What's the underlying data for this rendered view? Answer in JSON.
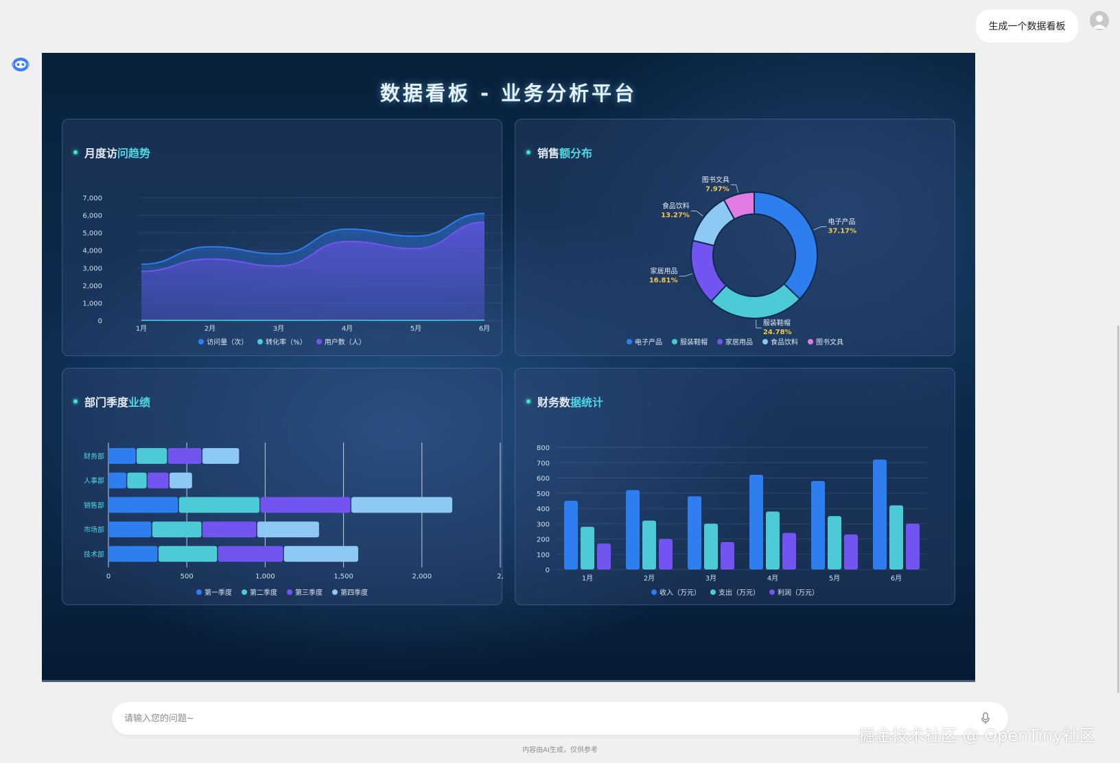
{
  "chat": {
    "user_message": "生成一个数据看板",
    "input_placeholder": "请输入您的问题~",
    "footnote": "内容由AI生成，仅供参考",
    "watermark": "掘金技术社区 @ OpenTiny社区"
  },
  "dashboard": {
    "title": "数据看板 - 业务分析平台",
    "panels": [
      {
        "title_a": "月度访",
        "title_b": "问趋势"
      },
      {
        "title_a": "销售",
        "title_b": "额分布"
      },
      {
        "title_a": "部门季度",
        "title_b": "业绩"
      },
      {
        "title_a": "财务数",
        "title_b": "据统计"
      }
    ]
  },
  "colors": {
    "blue": "#2f7ef0",
    "teal": "#4ccad6",
    "purple": "#7255f0",
    "light": "#8ec9f3",
    "pink": "#e27ae3",
    "label_yellow": "#f5c84c"
  },
  "chart_data": [
    {
      "type": "area",
      "categories": [
        "1月",
        "2月",
        "3月",
        "4月",
        "5月",
        "6月"
      ],
      "series": [
        {
          "name": "访问量（次）",
          "color": "#2f7ef0",
          "values": [
            3200,
            4200,
            3800,
            5200,
            4800,
            6100
          ]
        },
        {
          "name": "转化率（%）",
          "color": "#4ccad6",
          "values": [
            3,
            4,
            3,
            5,
            4,
            6
          ]
        },
        {
          "name": "用户数（人）",
          "color": "#7255f0",
          "values": [
            2800,
            3500,
            3100,
            4500,
            4100,
            5600
          ]
        }
      ],
      "yticks": [
        "0",
        "1,000",
        "2,000",
        "3,000",
        "4,000",
        "5,000",
        "6,000",
        "7,000"
      ],
      "ylim": [
        0,
        7000
      ]
    },
    {
      "type": "pie",
      "slices": [
        {
          "name": "电子产品",
          "label": "37.17%",
          "value": 37.17,
          "color": "#2f7ef0"
        },
        {
          "name": "服装鞋帽",
          "label": "24.78%",
          "value": 24.78,
          "color": "#4ccad6"
        },
        {
          "name": "家居用品",
          "label": "16.81%",
          "value": 16.81,
          "color": "#7255f0"
        },
        {
          "name": "食品饮料",
          "label": "13.27%",
          "value": 13.27,
          "color": "#8ec9f3"
        },
        {
          "name": "图书文具",
          "label": "7.97%",
          "value": 7.97,
          "color": "#e27ae3"
        }
      ]
    },
    {
      "type": "bar",
      "orientation": "horizontal",
      "stacked": true,
      "categories": [
        "财务部",
        "人事部",
        "销售部",
        "市场部",
        "技术部"
      ],
      "series": [
        {
          "name": "第一季度",
          "color": "#2f7ef0",
          "values": [
            180,
            120,
            450,
            280,
            320
          ]
        },
        {
          "name": "第二季度",
          "color": "#4ccad6",
          "values": [
            200,
            130,
            520,
            320,
            380
          ]
        },
        {
          "name": "第三季度",
          "color": "#7255f0",
          "values": [
            220,
            140,
            580,
            350,
            420
          ]
        },
        {
          "name": "第四季度",
          "color": "#8ec9f3",
          "values": [
            240,
            150,
            650,
            400,
            480
          ]
        }
      ],
      "xticks": [
        "0",
        "500",
        "1,000",
        "1,500",
        "2,000",
        "2,"
      ],
      "xlim": [
        0,
        2500
      ]
    },
    {
      "type": "bar",
      "categories": [
        "1月",
        "2月",
        "3月",
        "4月",
        "5月",
        "6月"
      ],
      "series": [
        {
          "name": "收入（万元）",
          "color": "#2f7ef0",
          "values": [
            450,
            520,
            480,
            620,
            580,
            720
          ]
        },
        {
          "name": "支出（万元）",
          "color": "#4ccad6",
          "values": [
            280,
            320,
            300,
            380,
            350,
            420
          ]
        },
        {
          "name": "利润（万元）",
          "color": "#7255f0",
          "values": [
            170,
            200,
            180,
            240,
            230,
            300
          ]
        }
      ],
      "yticks": [
        "0",
        "100",
        "200",
        "300",
        "400",
        "500",
        "600",
        "700",
        "800"
      ],
      "ylim": [
        0,
        800
      ]
    }
  ]
}
